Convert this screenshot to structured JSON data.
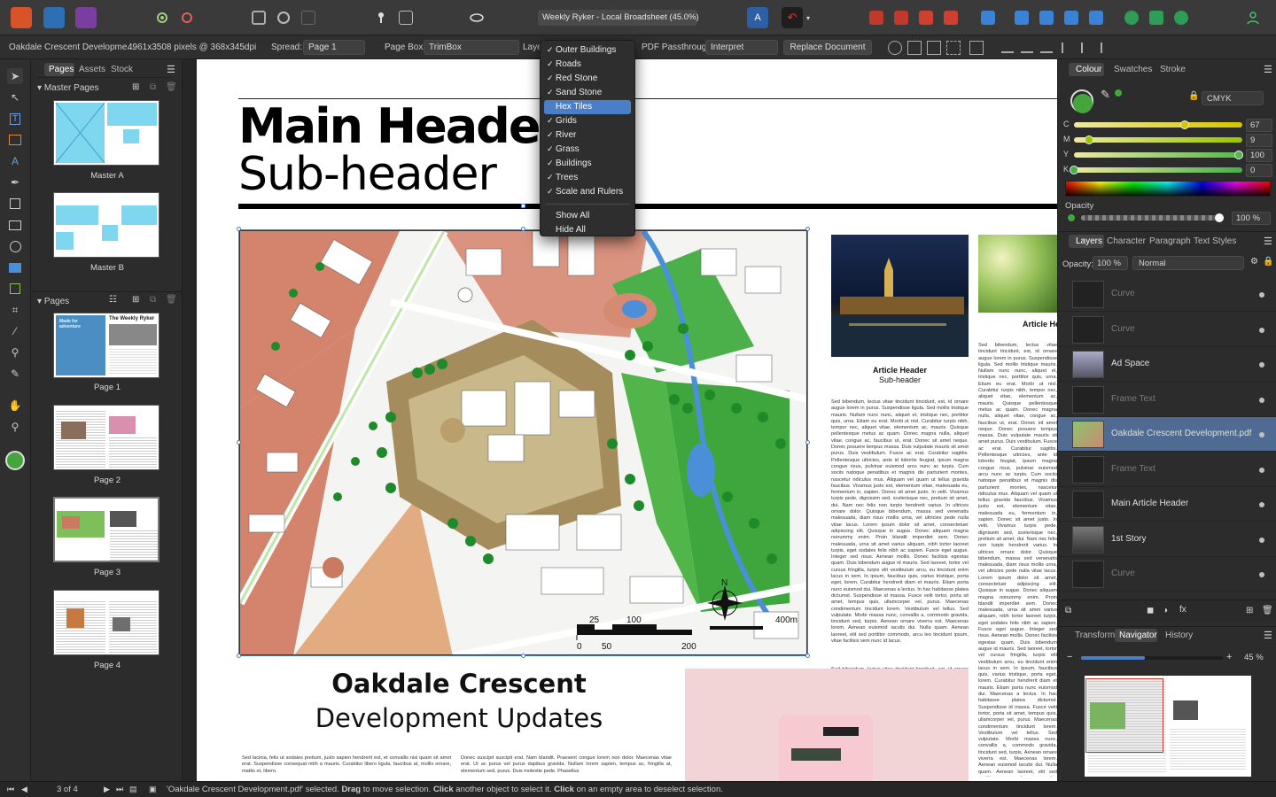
{
  "app": {
    "document_title": "Weekly Ryker - Local Broadsheet (45.0%)",
    "accent": "#4a7fc8"
  },
  "context_bar": {
    "doc_name": "Oakdale Crescent Developme...",
    "doc_info": "4961x3508 pixels @ 368x345dpi",
    "spread_label": "Spread:",
    "spread_value": "Page 1",
    "pagebox_label": "Page Box:",
    "pagebox_value": "TrimBox",
    "layers_label": "Laye",
    "passthrough_label": "PDF Passthrough:",
    "passthrough_value": "Interpret",
    "replace_button": "Replace Document"
  },
  "layers_menu": {
    "items": [
      {
        "label": "Outer Buildings",
        "checked": true
      },
      {
        "label": "Roads",
        "checked": true
      },
      {
        "label": "Red Stone",
        "checked": true
      },
      {
        "label": "Sand Stone",
        "checked": true
      },
      {
        "label": "Hex Tiles",
        "checked": false,
        "highlighted": true
      },
      {
        "label": "Grids",
        "checked": true
      },
      {
        "label": "River",
        "checked": true
      },
      {
        "label": "Grass",
        "checked": true
      },
      {
        "label": "Buildings",
        "checked": true
      },
      {
        "label": "Trees",
        "checked": true
      },
      {
        "label": "Scale and Rulers",
        "checked": true
      }
    ],
    "show_all": "Show All",
    "hide_all": "Hide All"
  },
  "left_panel": {
    "tabs": [
      "Pages",
      "Assets",
      "Stock"
    ],
    "master_header": "Master Pages",
    "masters": [
      "Master A",
      "Master B"
    ],
    "pages_header": "Pages",
    "pages": [
      "Page 1",
      "Page 2",
      "Page 3",
      "Page 4"
    ],
    "page1_magazine_title": "The Weekly Ryker",
    "page1_cover_text": "Made for adventure"
  },
  "page": {
    "main_header": "Main Header",
    "sub_header": "Sub-header",
    "map_scale": {
      "n": "N",
      "t25": "25",
      "t100": "100",
      "t0": "0",
      "t50": "50",
      "t200": "200",
      "t400": "400m"
    },
    "article1_header": "Article Header",
    "article1_sub": "Sub-header",
    "article2_header": "Article He",
    "bottom_title_1": "Oakdale Crescent",
    "bottom_title_2": "Development Updates",
    "col_text_1": "Sed lacinia, felis ut sodales pretium, justo sapien hendrerit est, et convallis nisi quam sit amet erat. Suspendisse consequat nibh a mauris. Curabitur libero ligula, faucibus at, mollis ornare, mattis et, libero.",
    "col_text_2": "Donec suscipit suscipit erat. Nam blandit. Praesent congue lorem non dolor. Maecenas vitae erat. Ut ac purus vel purus dapibus gravida. Nullam lorem sapien, tempus ac, fringilla at, elementum sed, purus. Duis molestie pede. Phasellus",
    "lorem": "Sed bibendum, lectus vitae tincidunt tincidunt, est, id ornare augue lorem in purus. Suspendisse ligula. Sed mollis tristique mauris. Nullam nunc nunc, aliquet et, tristique nec, porttitor quis, urna. Etiam eu erat. Morbi ut nisl. Curabitur turpis nibh, tempor nec, aliquet vitae, elementum ac, mauris. Quisque pellentesque metus ac quam. Donec magna nulla, aliquet vitae, congue ac, faucibus ut, erat. Donec sit amet neque. Donec posuere tempus massa. Duis vulputate mauris sit amet purus. Duis vestibulum. Fusce ac erat. Curabitur sagittis. Pellentesque ultricies, ante id lobortis feugiat, ipsum magna congue risus, pulvinar euismod arcu nunc ac turpis. Cum sociis natoque penatibus et magnis dis parturient montes, nascetur ridiculus mus. Aliquam vel quam ut tellus gravida faucibus. Vivamus justo est, elementum vitae, malesuada eu, fermentum in, sapien. Donec sit amet justo. In velit. Vivamus turpis pede, dignissim sed, scelerisque nec, pretium sit amet, dui. Nam nec felis non turpis hendrerit varius. In ultrices ornare dolor. Quisque bibendum, massa sed venenatis malesuada, diam risus mollis urna, vel ultricies pede nulla vitae lacus. Lorem ipsum dolor sit amet, consectetuer adipiscing elit. Quisque in augue. Donec aliquam magna nonummy enim. Proin blandit imperdiet sem. Donec malesuada, urna sit amet varius aliquam, nibh tortor laoreet turpis, eget sodales felis nibh ac sapien. Fusce eget augue. Integer sed risus. Aenean mollis. Donec facilisis egestas quam. Duis bibendum augue id mauris. Sed laoreet, tortor vel cursus fringilla, turpis elit vestibulum arcu, eu tincidunt enim lacus in sem. In ipsum, faucibus quis, varius tristique, porta eget, lorem. Curabitur hendrerit diam et mauris. Etiam porta nunc euismod dui. Maecenas a lectus. In hac habitasse platea dictumst. Suspendisse id massa. Fusce velit tortor, porta sit amet, tempus quis, ullamcorper vel, purus. Maecenas condimentum tincidunt lorem. Vestibulum vel tellus. Sed vulputate. Morbi massa nunc, convallis a, commodo gravida, tincidunt sed, turpis. Aenean ornare viverra est. Maecenas lorem. Aenean euismod iaculis dui. Nulla quam. Aenean laoreet, elit sed porttitor commodo, arcu leo tincidunt ipsum, vitae facilisis sem nunc id lacus."
  },
  "right_panel": {
    "top_tabs": [
      "Colour",
      "Swatches",
      "Stroke"
    ],
    "color_model": "CMYK",
    "cmyk": [
      {
        "label": "C",
        "value": "67",
        "pct": 0.67,
        "color": "#d6c300"
      },
      {
        "label": "M",
        "value": "9",
        "pct": 0.09,
        "color": "#99c400"
      },
      {
        "label": "Y",
        "value": "100",
        "pct": 1.0,
        "color": "#52b84d"
      },
      {
        "label": "K",
        "value": "0",
        "pct": 0.0,
        "color": "#45b04a"
      }
    ],
    "fill_color": "#45a53d",
    "opacity_label": "Opacity",
    "opacity_value": "100 %",
    "layer_tabs": [
      "Layers",
      "Character",
      "Paragraph",
      "Text Styles"
    ],
    "layer_opacity_label": "Opacity:",
    "layer_opacity_value": "100 %",
    "blend_mode": "Normal",
    "layers": [
      {
        "name": "Curve",
        "dim": true,
        "selected": false
      },
      {
        "name": "Curve",
        "dim": true,
        "selected": false
      },
      {
        "name": "Ad Space",
        "dim": false,
        "selected": false
      },
      {
        "name": "Frame Text",
        "dim": true,
        "selected": false
      },
      {
        "name": "Oakdale Crescent Development.pdf",
        "dim": false,
        "selected": true
      },
      {
        "name": "Frame Text",
        "dim": true,
        "selected": false
      },
      {
        "name": "Main Article Header",
        "dim": false,
        "selected": false
      },
      {
        "name": "1st Story",
        "dim": false,
        "selected": false
      },
      {
        "name": "Curve",
        "dim": true,
        "selected": false
      }
    ],
    "bottom_tabs": [
      "Transform",
      "Navigator",
      "History"
    ],
    "zoom_value": "45 %",
    "zoom_level": 0.45
  },
  "status": {
    "page_counter": "3 of 4",
    "msg_file": "'Oakdale Crescent Development.pdf'",
    "msg_selected": " selected. ",
    "msg_drag": "Drag",
    "msg_move": " to move selection. ",
    "msg_click": "Click",
    "msg_another": " another object to select it. ",
    "msg_click2": "Click",
    "msg_empty": " on an empty area to deselect selection."
  }
}
